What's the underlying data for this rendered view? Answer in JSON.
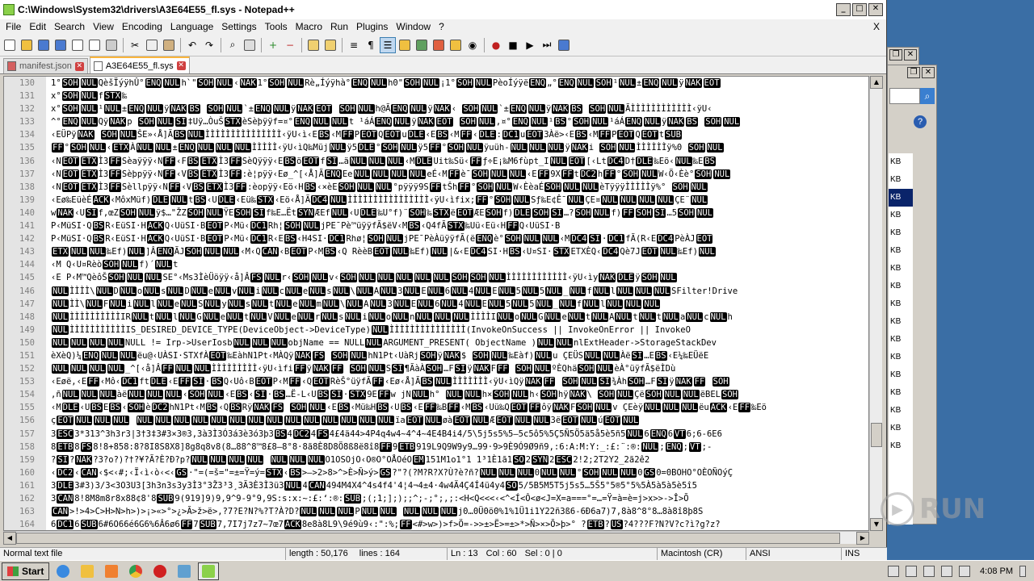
{
  "window": {
    "title": "C:\\Windows\\System32\\drivers\\A3E64E55_fl.sys - Notepad++"
  },
  "menu": [
    "File",
    "Edit",
    "Search",
    "View",
    "Encoding",
    "Language",
    "Settings",
    "Tools",
    "Macro",
    "Run",
    "Plugins",
    "Window",
    "?"
  ],
  "menu_close": "X",
  "tabs": [
    {
      "label": "manifest.json",
      "active": false
    },
    {
      "label": "A3E64E55_fl.sys",
      "active": true
    }
  ],
  "lines": [
    {
      "n": "130",
      "t": "1°[SOH][NUL]QèšÏýÿhÛ°[ENQ][NUL]h`\"[SOH][NUL]‹[NAK]1°[SOH][NUL]Rè„Íýÿhà°[ENQ][NUL]h0\"[SOH][NUL]¡1°[SOH][NUL]PèoÍýÿë[ENQ]„°[ENQ][NUL][SOH]¹[NUL]±[ENQ][NUL]ÿ[NAK][EOT]"
    },
    {
      "n": "131",
      "t": "x°[SOH][NUL]f[STX]‰"
    },
    {
      "n": "132",
      "t": "x°[SOH][NUL]¹[NUL]±[ENQ][NUL]ÿ[NAK][BS] [SOH][NUL]`±[ENQ][NUL]ÿ[NAK][EOT] [SOH][NUL]h@Ã[ENQ][NUL]ÿ[NAK]‹ [SOH][NUL]`±[ENQ][NUL]ÿ[NAK][BS] [SOH][NUL]ÃÌÌÌÌÌÌÌÌÌÌÌÌ‹ÿU‹"
    },
    {
      "n": "133",
      "t": "^°[ENQ][NUL]Qÿ[NAK]p [SOH][NUL][SI]‡Uÿ…ÒuŠ[STX]èSèþÿÿf=¤°[ENQ][NUL][NUL]t ¹áÁ[ENQ][NUL]ÿ[NAK][EOT] [SOH][NUL],¤°[ENQ][NUL]¹[BS]°[SOH][NUL]¹áÁ[ENQ][NUL]ÿ[NAK][BS] [SOH][NUL]"
    },
    {
      "n": "134",
      "t": "‹EÜPÿ[NAK] [SOH][NUL]ŠE»‹Å]Ã[BS][NUL]ÌÌÌÌÌÌÌÌÌÌÌÌÌÌÌ‹ÿU‹ì‹E[BS]‹M[FF]P[EOT]Q[EOT]u[DLE]‹E[BS]‹M[FF]‹[DLE]:[DC1]u[EOT]3Àë>‹E[BS]‹M[FF]P[EOT]Q[EOT]t[SUB]"
    },
    {
      "n": "135",
      "t": "[FF]°[SOH][NUL]‹[ETX]À[NUL][NUL]±[ENQ][NUL][NUL][NUL]ÌÌÌÌÌ‹ÿU‹ìQ‰Müj[NUL]ÿ5[DLE]°[SOH][NUL]ÿ5[FF]°[SOH][NUL]ÿuüh-[NUL][NUL][NUL]ÿ[NAK]i [SOH][NUL]ÌÌÌÌÌÌÿ%0 [SOH][NUL]"
    },
    {
      "n": "136",
      "t": "‹N[EOT][ETX]Ì3[FF]Sèaÿÿÿ‹N[FF]‹F[BS][ETX]Ì3[FF]SèQÿÿÿ‹E[BS]ö[EOT]f[SI]…ä[NUL][NUL][NUL]‹M[DLE]Uit‰Sü‹[FF]ƒ÷E¡‰M6fùpt_I[NUL][EOT][‹Lt[DC4]D†[DLE]‰Eö‹[NUL]‰E[BS]"
    },
    {
      "n": "137",
      "t": "‹N[EOT][ETX]Ì3[FF]Sèþpÿÿ‹N[FF]‹V[BS][ETX]Ì3[FF]:è¦pÿÿ‹Eø_^[‹Å]Ã[ENQ]Ee[NUL][NUL][NUL][NUL]eÉ‹M[FF]è¯[SOH][NUL][NUL]‹E[FF]9X[FF]t[DC2]h[FF]°[SOH][NUL]W‹Ö‹Èè°[SOH][NUL]"
    },
    {
      "n": "138",
      "t": "‹N[EOT][ETX]Ì3[FF]Sèllpÿÿ‹N[FF]‹V[BS][ETX]Ì3[FF]:èopÿÿ‹Eö‹H[BS]‹×èE[SOH][NUL][NUL]°pÿÿÿ9S[FF]tŠh[FF]°[SOH][NUL]W‹ÈèaÉ[SOH][NUL][NUL]èTÿÿÿÌÌÌÌÌÿ%° [SOH][NUL]"
    },
    {
      "n": "139",
      "t": "‹Eø‰EüèÉ[ACK]‹MôxMüf)[DLE][NUL]t[BS]‹U[DLE]‹Eü‰[STX]‹Eö‹Å]Ã[DC4][NUL]ÌÌÌÌÌÌÌÌÌÌÌÌÌÌÌÌ‹ÿU‹ìfix;[FF]°[SOH][NUL]Sƒ‰E¢Ê¯[NUL]ÇE¤[NUL][NUL][NUL][NUL]ÇE¨[NUL]"
    },
    {
      "n": "140",
      "t": "w[NAK]‹U[SI]f,œZ[SOH][NUL]ÿ$…\"ŽZ[SOH][NUL]ŸE[SOH][SI]f‰E…Ët[SYN]ÆEf[NUL]‹U[DLE]‰U°f)¨[SOH]‰[STX]ë[EOT]ÆE[SOH]f)[DLE][SOH][SI]…?[SOH][NUL]f)[FF][SOH][SI]…5[SOH][NUL]"
    },
    {
      "n": "141",
      "t": "P‹MüSI·Q[BS]R‹EüSI·H[ACK]Q‹UüSI·B[EOT]P‹Mü‹[DC1]Rh¦[SOH][NUL]jPE¯Pè™üÿÿfÃ$ëV‹M[BS]‹Q4fÃ[STX]‰Uü‹Eü‹H[FF]Q‹UüSI·B"
    },
    {
      "n": "142",
      "t": "P‹MüSI·Q[BS]R‹EüSI·H[ACK]Q‹UüSI·B[EOT]P‹Mü‹[DC1]R‹E[BS]‹H4SI·[DC1]Rhø¦[SOH][NUL]jPE¯PèÀüÿÿfÃ(ë[ENQ]è°[SOH][NUL][NUL]‹M[DC4][SI]·[DC1]fÃ(R‹E[DC4]PèÀJ[EOT]"
    },
    {
      "n": "143",
      "t": "[ETX][NUL][NUL]‰Ef)[NUL]]Â[ENQ]ÃJ[SOH][NUL][NUL]‹M‹Q[CAN]‹B[EOT]P‹M[BS]‹Q RèèB[EOT][NUL]‰Ef)[NUL]|&‹E[DC4]SI·H[BS]‹U¤SI·[STX]ETXÈQ‹[DC4]Qè7J[EOT][NUL]‰Ef)[NUL]"
    },
    {
      "n": "144",
      "t": "‹M Q‹U¤Rèò[SOH][NUL]f)´[NUL]t"
    },
    {
      "n": "145",
      "t": "‹E P‹M™QèôŠ[SOH][NUL][NUL]SE°‹Ms3ÌèÜöÿÿ‹å]Â[FS][NUL]r‹[SOH][NUL]v‹[SOH][NUL][NUL][NUL][NUL][NUL][SOH][SOH][NUL]ÌÌÌÌÌÌÌÌÌÌÌÌ‹ÿU‹ìy[NAK][DLE]ÿ[SOH][NUL]"
    },
    {
      "n": "146",
      "t": "[NUL]ÌÌÌÌ\\[NUL]D[NUL]o[NUL]s[NUL]D[NUL]e[NUL]v[NUL]i[NUL]c[NUL]e[NUL]s[NUL]\\[NUL]A[NUL]3[NUL]E[NUL]6[NUL]4[NUL]E[NUL]5[NUL]5[NUL]_[NUL]f[NUL]l[NUL][NUL][NUL]SFilter!Drive"
    },
    {
      "n": "147",
      "t": "[NUL]ÌÌ\\[NUL]F[NUL]i[NUL]l[NUL]e[NUL]S[NUL]y[NUL]s[NUL]t[NUL]e[NUL]m[NUL]\\[NUL]A[NUL]3[NUL]E[NUL]6[NUL]4[NUL]E[NUL]5[NUL]5[NUL]_[NUL]f[NUL]l[NUL][NUL][NUL]"
    },
    {
      "n": "148",
      "t": "[NUL]ÌÌÌÌÌÌÌÌÌÌIR[NUL]t[NUL]l[NUL]G[NUL]e[NUL]t[NUL]V[NUL]e[NUL]r[NUL]s[NUL]i[NUL]o[NUL]n[NUL][NUL][NUL]ÌÌÌÌI[NUL]o[NUL]G[NUL]e[NUL]t[NUL]A[NUL]t[NUL]t[NUL]a[NUL]c[NUL]h"
    },
    {
      "n": "149",
      "t": "[NUL]ÌÌÌÌÌÌÌÌÌÌÌIS_DESIRED_DEVICE_TYPE(DeviceObject->DeviceType)[NUL]ÌÌÌÌÌÌÌÌÌÌÌÌÌÌÌ(InvokeOnSuccess || InvokeOnError || InvokeO"
    },
    {
      "n": "150",
      "t": "[NUL][NUL][NUL][NUL]NULL != Irp->UserIosb[NUL][NUL][NUL]objName == NULL[NUL]ARGUMENT_PRESENT( ObjectName )[NUL][NUL]nlExtHeader->StorageStackDev"
    },
    {
      "n": "151",
      "t": "èXèQ)¼[ENQ][NUL][NUL]ëu@‹UÀSI·STXfÀ[EOT]‰EàhN1Pt‹MÀQÿ[NAK][FS] [SOH][NUL]hN1Pt‹UàRj[SOH]ÿ[NAK]$ [SOH][NUL]‰Eàf)[NUL]u ÇEÜS[NUL][NUL]Àë[SI]…E[BS]‹E¼‰EÜëE"
    },
    {
      "n": "152",
      "t": "[NUL][NUL][NUL][NUL]_^[‹å]Â[FF][NUL][NUL]ÌÌÌÌÌÌÌÌÌ‹ÿU‹ìfi[FF]ÿ[NAK][FF] [SOH][NUL]S[SI]¶ÃàÀ[SOH]…F[SI]ÿ[NAK]F[FF] [SOH][NUL]ºÈQhä[SOH][NUL]èÀ°üÿfÃ$ëÌDù"
    },
    {
      "n": "153",
      "t": "‹Eøë‚‹E[FF]‹Mô‹[DC1]ft[DLE]‹E[FF][SI]·[BS]Q‹Uô‹B[EOT]P‹M[FF]‹Q[EOT]RèŠ°üÿfÃ[FF]‹Eø‹Å]Ã[BS][NUL]ÌÌÌÌÌÌÌ‹ÿU‹ìQÿ[NAK][FF] [SOH][NUL][SI]¾Àh[SOH]…F[SI]ÿ[NAK][FF] [SOH]"
    },
    {
      "n": "154",
      "t": "‚ñ[NUL][NUL][NUL]àë[NUL][NUL][NUL]‹[SOH][NUL]‹E[BS]‹[SI]·[BS]…Ë-L‹U[BS][SI]·[STX]9E[FF]w jN[NUL]h° [NUL][NUL]h×[SOH][NUL]h‹[SOH]hÿ[NAK]\\ [SOH][NUL]Çë[SOH][NUL][NUL]ëBEL[SOH]"
    },
    {
      "n": "155",
      "t": "‹M[DLE]‹U[BS]E[BS]‹[SOH]è[DC2]hN1Pt‹M[BS]‹Q[BS]Rÿ[NAK][FS] [SOH][NUL]‹E[BS]‹Mü‰H[BS]‹U[BS]‹E[FF]‰B[FF]‹M[BS]‹Uü‰Q[EOT][FF]ôÿ[NAK]F[SOH][NUL]v ÇEèÿ[NUL][NUL][NUL]ëu[ACK]‹E[FF]‰Eö"
    },
    {
      "n": "156",
      "t": "ç[EOT][NUL][NUL][NUL] [NUL][NUL][NUL][NUL][NUL][NUL][NUL][NUL][NUL][NUL][NUL][NUL][NUL][NUL]ïa[EOT][NUL]øà[EOT][NUL]Æ[EOT][NUL][NUL]3ë[EOT][NUL]ú[EOT][NUL]"
    },
    {
      "n": "157",
      "t": "3[ESC]3*313^3h3r3|3†3‡3#3×3®3,3à3Ì3Ó3á3è3ó3þ3[BS]4[DC2]4[FS]4£4ä44>4P4q4w4~4^4~4E4B4i4/5\\5j5s5%5—5c5ô5%5Ç5Ñ5Ö5ä5å5è5ñ5[NUL]6[ENQ]6[VT]6;6-6E6"
    },
    {
      "n": "158",
      "t": "8[ETB]8[FS]8!8+858:8?8I8S8X8]8g8q8v8(8…88^8™8£8—8°8·8ã8È8D8Ö8ß8ë8î8[FF]9[ETB]919L9Q9W9y9…99·9>9È9Ó9Ø9ñ9,:6:A:M:Y:_:£:¨:®:[NUL];[ENQ];[VT];-"
    },
    {
      "n": "159",
      "t": "?[SI]?[NAK]?3?o?)?†?¥?Ã?È?Ð?p?[NUL][NUL][NUL][NUL] [NUL][NUL][NUL]O1OSOjO‹O®O°OÅOéO[EM]151M1o1°1 1³1È1ã1[SO]2[SYN]2[ESC]2!2;2T2Y2_2ã2ê2"
    },
    {
      "n": "160",
      "t": "‹[DC2]‹[CAN]‹$<‹#;‹Ï‹ì‹ò‹<‹[GS]·\"=(=š=\"=±=Ÿ=ý=[STX]‹[BS]>–>2>8>^>È>Ñ>ý>[GS]?\"?(?M?R?X?Ù?è?ñ?[NUL][NUL][NUL]0[NUL][NUL]°[SOH][NUL][NUL]0[GS]0=0BOHO°OÈOÑOýÇ"
    },
    {
      "n": "161",
      "t": "3[DLE]3#3)3/3<3O3U3[3h3n3s3y3Ì3°3Ž3³3¸3Ã3È3Ì3ü3[NUL]4[CAN]494M4X4^4s4f4'4¦4¬4±4·4w4Ä4Ç4Í4ü4y4[SO]5/5B5M5T5j5s5…5Š5°5®5°5%5À5à5à5è5î5"
    },
    {
      "n": "162",
      "t": "3[CAN]8!8M8m8r8x88¢8'8[SUB]9(919]9)9,9^9-9°9,9S:s:x:~:£:‘:®:[SUB];(;1;];);;^;-;°;,;:<H<Q<<<‹<^<Í<Ô<ø<J=X=a===°=…=Ÿ=à=è=j>x>>->Î>Õ"
    },
    {
      "n": "163",
      "t": "[CAN]>!>4>C>H>N>h>)>¡>«>°>¿>Ã>ž>ë>,?7?E?N?%?T?À?D?[NUL][NUL][NUL]P[NUL][NUL] [NUL][NUL][NUL]j0…0Ü0ö0%1%1Ü1i1Y22ñ3ß6-6Ð6a7)7,8à8^8°8…8à8î8þ8S"
    },
    {
      "n": "164",
      "t": "6[DC1]6[SUB]6#6O66é6G6%6Â6ø6[FF]7[SUB]7,7I7j7z7~7œ7[ACK]8e8à8L9\\9é9ù9‹:\":%;[FF]<#>w>)>f>Ö=->>±>Ë>=±>*>Ñ>×>Õ>þ>° ?[ETB]?[US]?4???F?N?V?c?ì?g?z?"
    }
  ],
  "status": {
    "type": "Normal text file",
    "length": "length : 50,176",
    "lines": "lines : 164",
    "ln": "Ln : 13",
    "col": "Col : 60",
    "sel": "Sel : 0 | 0",
    "eol": "Macintosh (CR)",
    "enc": "ANSI",
    "mode": "INS"
  },
  "kb_items": [
    "KB",
    "KB",
    "KB",
    "KB",
    "KB",
    "KB",
    "KB",
    "KB",
    "KB",
    "KB",
    "KB",
    "KB",
    "KB",
    "KB",
    "KB",
    "KB",
    "KB"
  ],
  "taskbar": {
    "start": "Start",
    "clock": "4:08 PM"
  },
  "watermark": "RUN",
  "colors": {
    "accent": "#fab53c",
    "selection": "#0a246a",
    "desktop": "#3a6ea5"
  }
}
